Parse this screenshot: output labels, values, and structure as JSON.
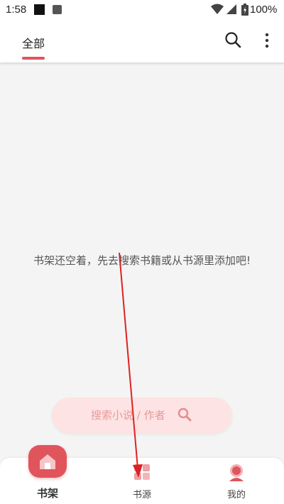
{
  "status_bar": {
    "time": "1:58",
    "battery_pct": "100%"
  },
  "header": {
    "tab_all": "全部"
  },
  "main": {
    "empty_message": "书架还空着，先去搜索书籍或从书源里添加吧!",
    "search_placeholder": "搜索小说 / 作者"
  },
  "bottom_nav": {
    "items": [
      {
        "label": "书架",
        "icon": "home-icon",
        "active": true
      },
      {
        "label": "书源",
        "icon": "grid-icon",
        "active": false
      },
      {
        "label": "我的",
        "icon": "person-icon",
        "active": false
      }
    ]
  },
  "colors": {
    "accent": "#e0545c",
    "pill_bg": "#fde3e3",
    "annotation": "#dd2222"
  }
}
